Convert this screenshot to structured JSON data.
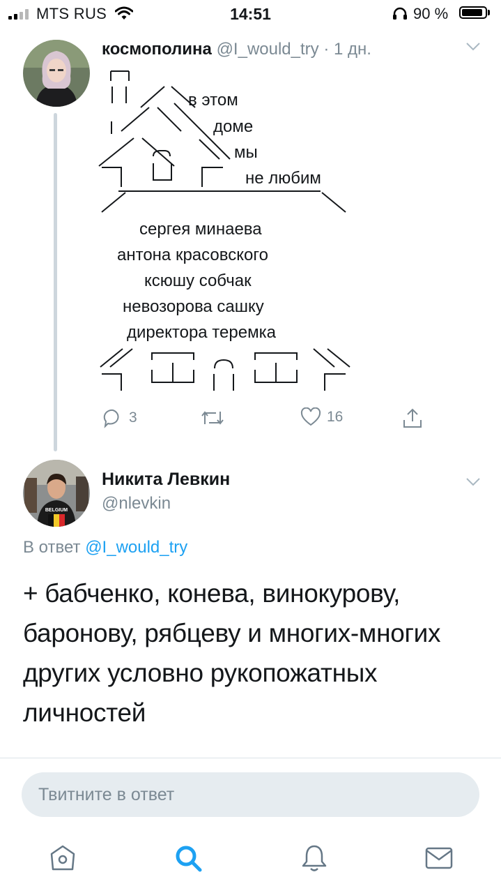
{
  "status_bar": {
    "carrier": "MTS RUS",
    "time": "14:51",
    "battery_percent": "90 %",
    "battery_level": 0.9,
    "signal_bars": 4,
    "signal_bars_filled": 2
  },
  "tweet1": {
    "author_name": "космополина",
    "handle": "@I_would_try",
    "separator": "·",
    "time_ago": "1 дн.",
    "house_words": [
      "в этом",
      "доме",
      "мы",
      "не любим"
    ],
    "lines": [
      "сергея минаева",
      "антона красовского",
      "ксюшу собчак",
      "невозорова сашку",
      "директора теремка"
    ],
    "replies": "3",
    "retweets": "",
    "likes": "16"
  },
  "tweet2": {
    "author_name": "Никита Левкин",
    "handle": "@nlevkin",
    "reply_prefix": "В ответ",
    "reply_handle": "@I_would_try",
    "avatar_shirt_text": "BELGIUM",
    "body": "+ бабченко, конева, винокурову, баронову, рябцеву и многих-многих других условно рукопожатных личностей"
  },
  "reply_box": {
    "placeholder": "Твитните в ответ"
  },
  "tab_bar": {
    "tabs": [
      {
        "icon": "home-icon",
        "active": false
      },
      {
        "icon": "search-icon",
        "active": true
      },
      {
        "icon": "bell-icon",
        "active": false
      },
      {
        "icon": "mail-icon",
        "active": false
      }
    ]
  },
  "colors": {
    "accent": "#1da1f2",
    "muted": "#7b8993",
    "text": "#14171a",
    "thread_line": "#cdd6dd",
    "reply_box_bg": "#e6ecf0"
  }
}
